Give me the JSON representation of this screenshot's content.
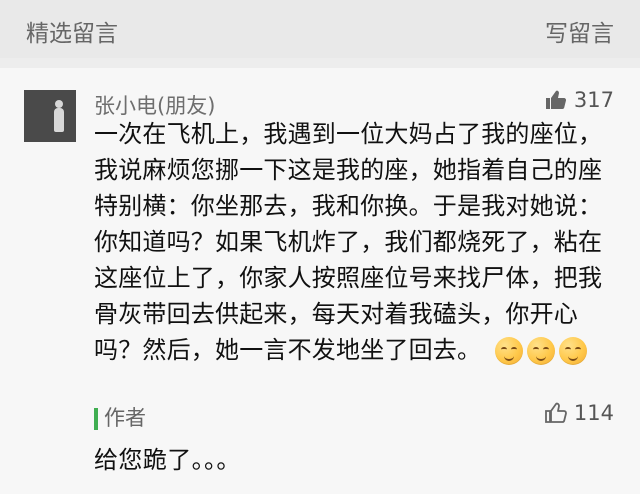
{
  "header": {
    "left_title": "精选留言",
    "right_action": "写留言"
  },
  "comment": {
    "author": "张小电(朋友)",
    "likes": "317",
    "text": "一次在飞机上，我遇到一位大妈占了我的座位，我说麻烦您挪一下这是我的座，她指着自己的座特别横：你坐那去，我和你换。于是我对她说：你知道吗？如果飞机炸了，我们都烧死了，粘在这座位上了，你家人按照座位号来找尸体，把我骨灰带回去供起来，每天对着我磕头，你开心吗？然后，她一言不发地坐了回去。",
    "emoji_count": 3,
    "reply": {
      "author": "作者",
      "likes": "114",
      "text": "给您跪了。。。"
    }
  },
  "icons": {
    "avatar": "avatar",
    "like": "thumbs-up-icon",
    "reply_like": "thumbs-up-icon",
    "emoji": "smiling-face-emoji"
  },
  "colors": {
    "background": "#ededed",
    "card": "#f7f7f7",
    "accent": "#3fae51"
  }
}
